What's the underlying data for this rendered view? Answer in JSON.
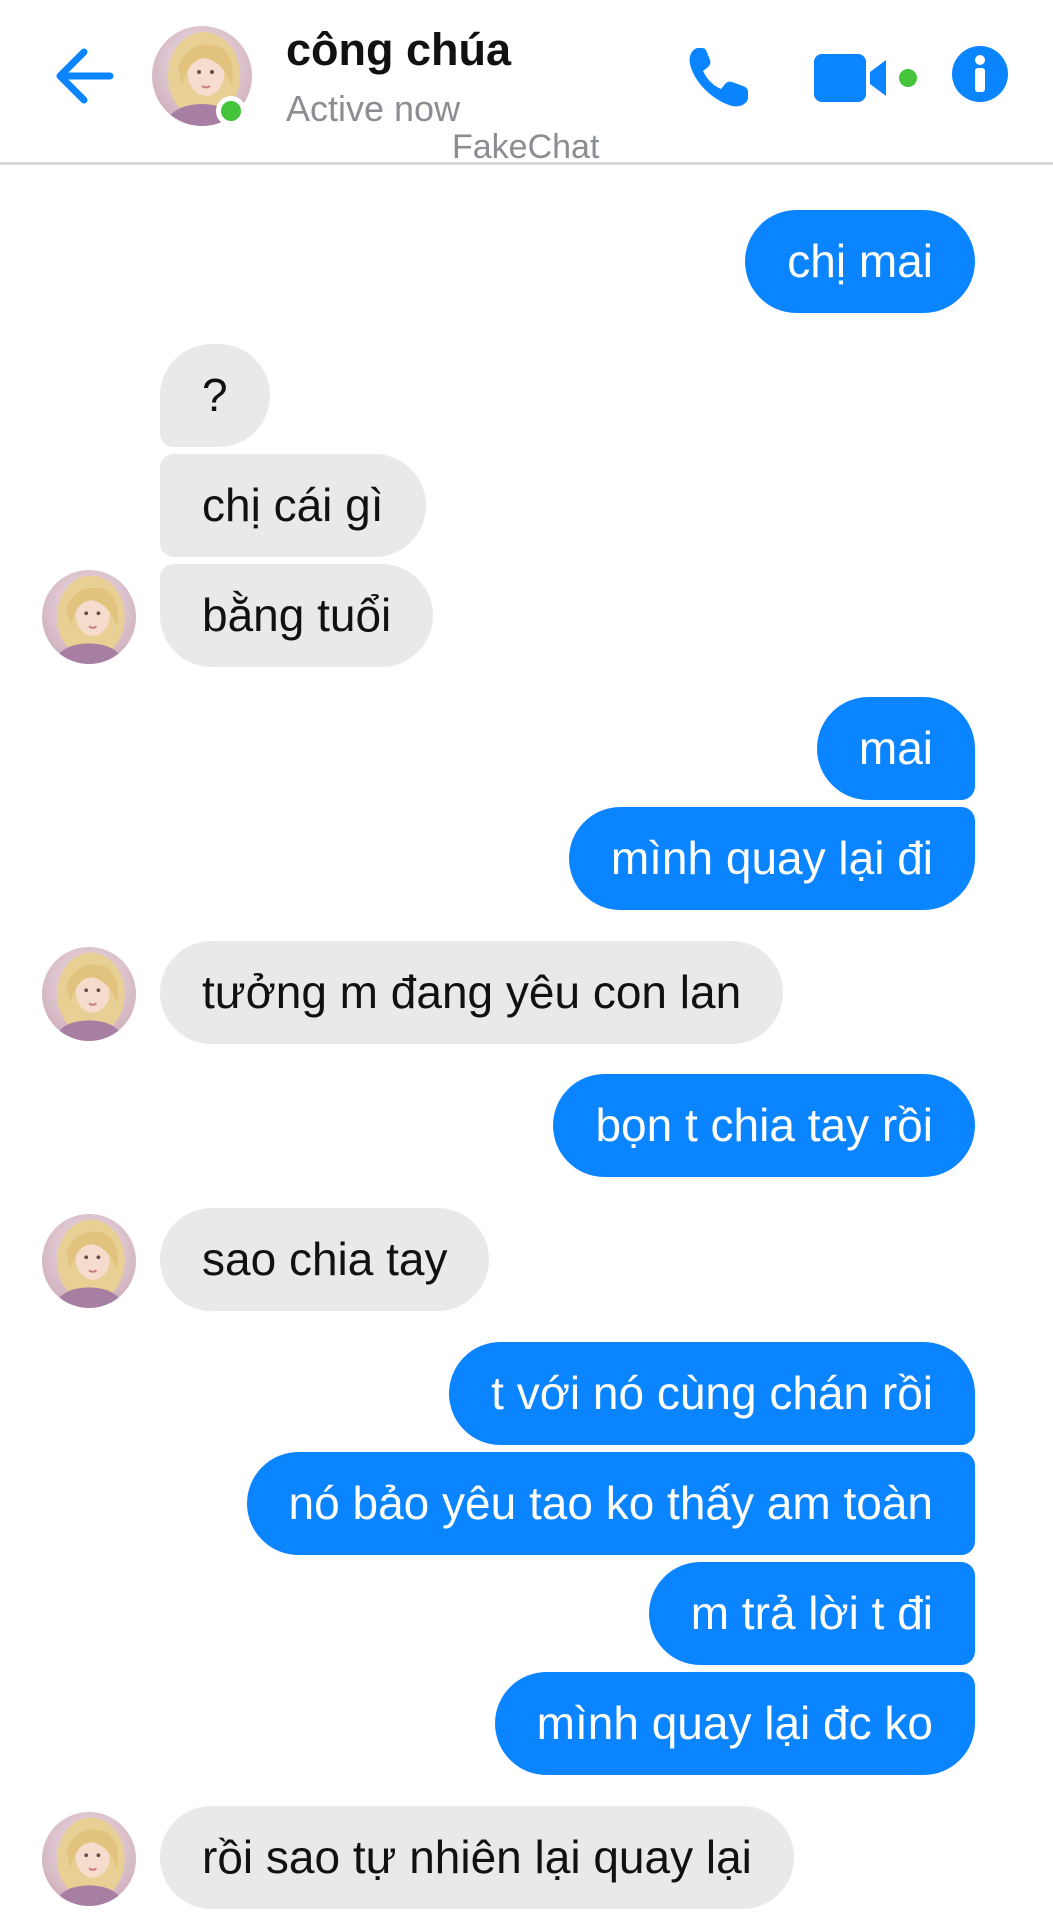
{
  "header": {
    "back_icon": "back-arrow-icon",
    "contact_name": "công chúa",
    "status": "Active now",
    "watermark": "FakeChat",
    "call_icon": "phone-icon",
    "video_icon": "video-camera-icon",
    "info_icon": "info-icon",
    "accent_color": "#0a84ff",
    "online_color": "#44c43b"
  },
  "messages": [
    {
      "side": "out",
      "text": "chị mai"
    },
    {
      "side": "in",
      "text": "?"
    },
    {
      "side": "in",
      "text": "chị cái gì"
    },
    {
      "side": "in",
      "text": "bằng tuổi"
    },
    {
      "side": "out",
      "text": "mai"
    },
    {
      "side": "out",
      "text": "mình quay lại đi"
    },
    {
      "side": "in",
      "text": "tưởng m đang yêu con lan"
    },
    {
      "side": "out",
      "text": "bọn t chia tay rồi"
    },
    {
      "side": "in",
      "text": "sao chia tay"
    },
    {
      "side": "out",
      "text": "t với nó cùng chán rồi"
    },
    {
      "side": "out",
      "text": "nó bảo yêu tao ko thấy am toàn"
    },
    {
      "side": "out",
      "text": "m trả lời t đi"
    },
    {
      "side": "out",
      "text": "mình quay lại đc ko"
    },
    {
      "side": "in",
      "text": "rồi sao tự nhiên lại quay lại"
    }
  ]
}
